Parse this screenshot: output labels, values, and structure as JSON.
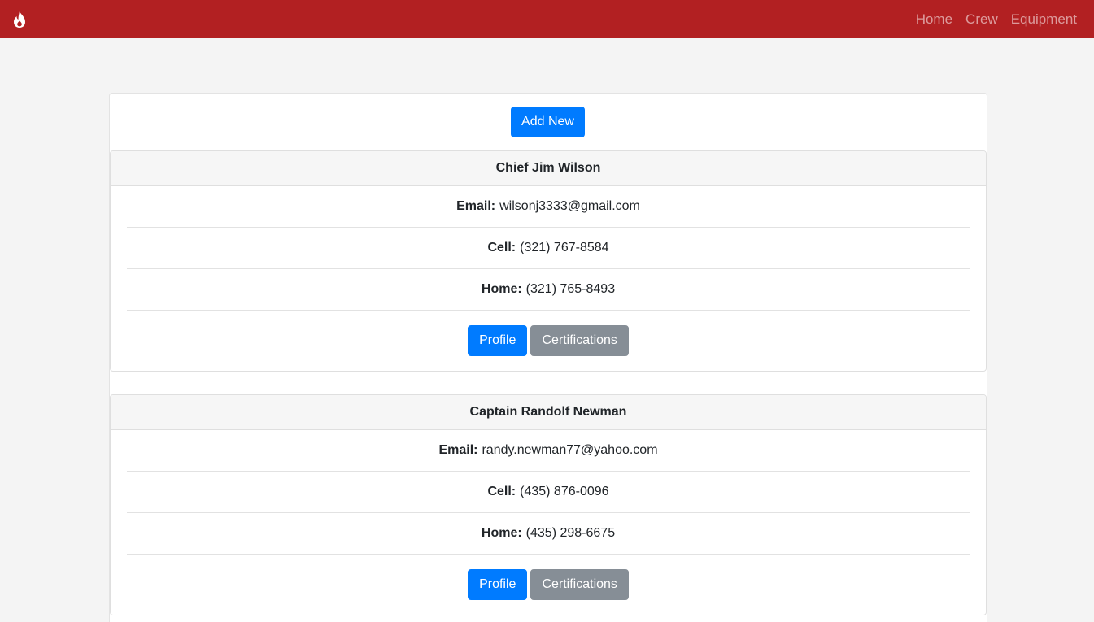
{
  "navbar": {
    "brand_icon": "fire-icon",
    "links": [
      "Home",
      "Crew",
      "Equipment"
    ]
  },
  "add_new_label": "Add New",
  "crew": [
    {
      "name": "Chief Jim Wilson",
      "email_label": "Email:",
      "email": "wilsonj3333@gmail.com",
      "cell_label": "Cell:",
      "cell": "(321) 767-8584",
      "home_label": "Home:",
      "home": "(321) 765-8493",
      "profile_label": "Profile",
      "certifications_label": "Certifications"
    },
    {
      "name": "Captain Randolf Newman",
      "email_label": "Email:",
      "email": "randy.newman77@yahoo.com",
      "cell_label": "Cell:",
      "cell": "(435) 876-0096",
      "home_label": "Home:",
      "home": "(435) 298-6675",
      "profile_label": "Profile",
      "certifications_label": "Certifications"
    }
  ],
  "colors": {
    "navbar": "#b22022",
    "primary": "#007bff",
    "secondary": "#868e96",
    "background": "#f4f4f4"
  }
}
